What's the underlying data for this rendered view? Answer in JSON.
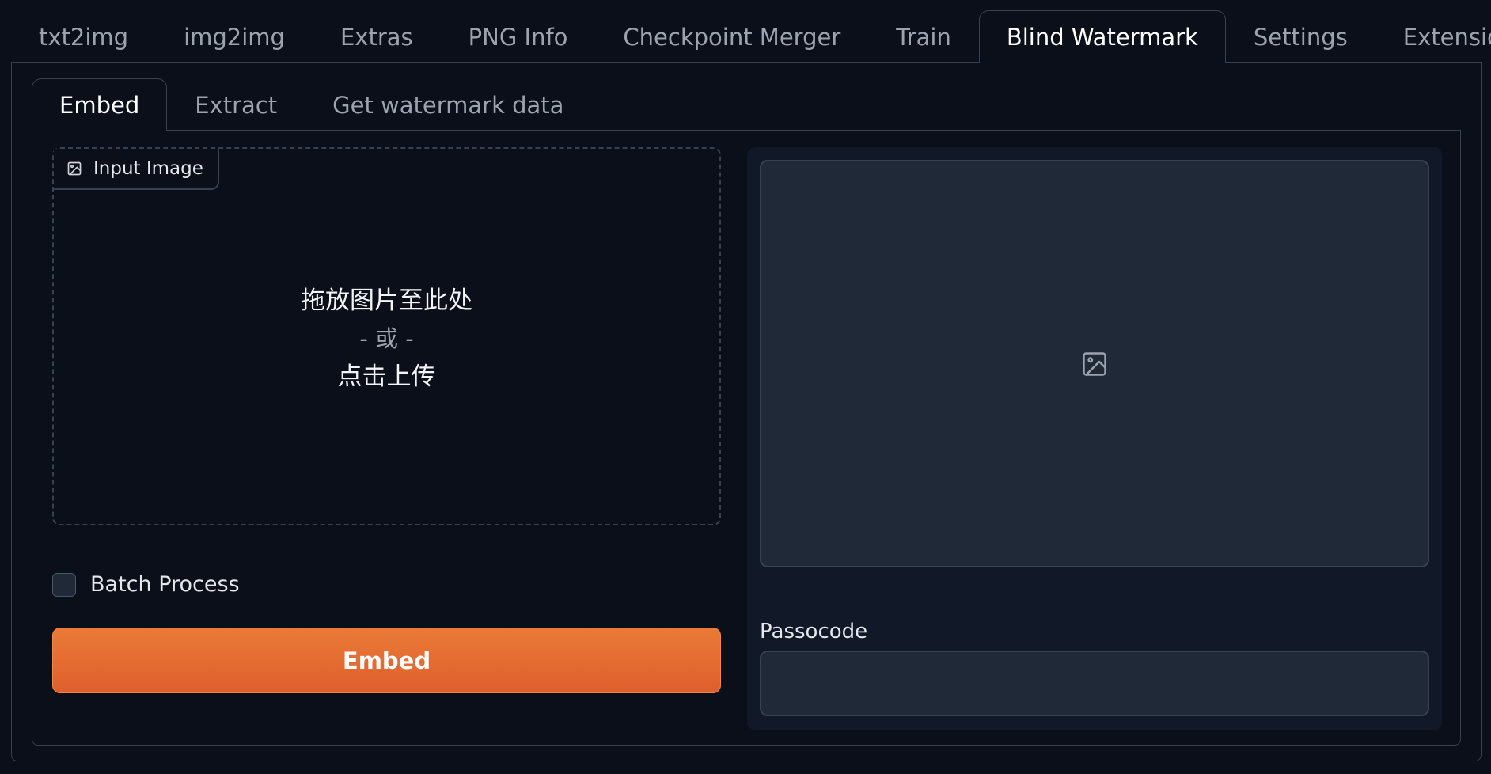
{
  "top_tabs": [
    {
      "label": "txt2img"
    },
    {
      "label": "img2img"
    },
    {
      "label": "Extras"
    },
    {
      "label": "PNG Info"
    },
    {
      "label": "Checkpoint Merger"
    },
    {
      "label": "Train"
    },
    {
      "label": "Blind Watermark",
      "selected": true
    },
    {
      "label": "Settings"
    },
    {
      "label": "Extensions"
    }
  ],
  "sub_tabs": [
    {
      "label": "Embed",
      "selected": true
    },
    {
      "label": "Extract"
    },
    {
      "label": "Get watermark data"
    }
  ],
  "input_image": {
    "label": "Input Image",
    "icon": "image-icon",
    "drop_text": "拖放图片至此处",
    "or_text": "- 或 -",
    "click_text": "点击上传"
  },
  "batch_process": {
    "label": "Batch Process",
    "checked": false
  },
  "embed_button": {
    "label": "Embed"
  },
  "output_image": {
    "icon": "image-placeholder-icon"
  },
  "passcode": {
    "label": "Passocode",
    "value": ""
  },
  "colors": {
    "background": "#0b0f19",
    "panel": "#111827",
    "border": "#374151",
    "accent": "#e8702f"
  }
}
